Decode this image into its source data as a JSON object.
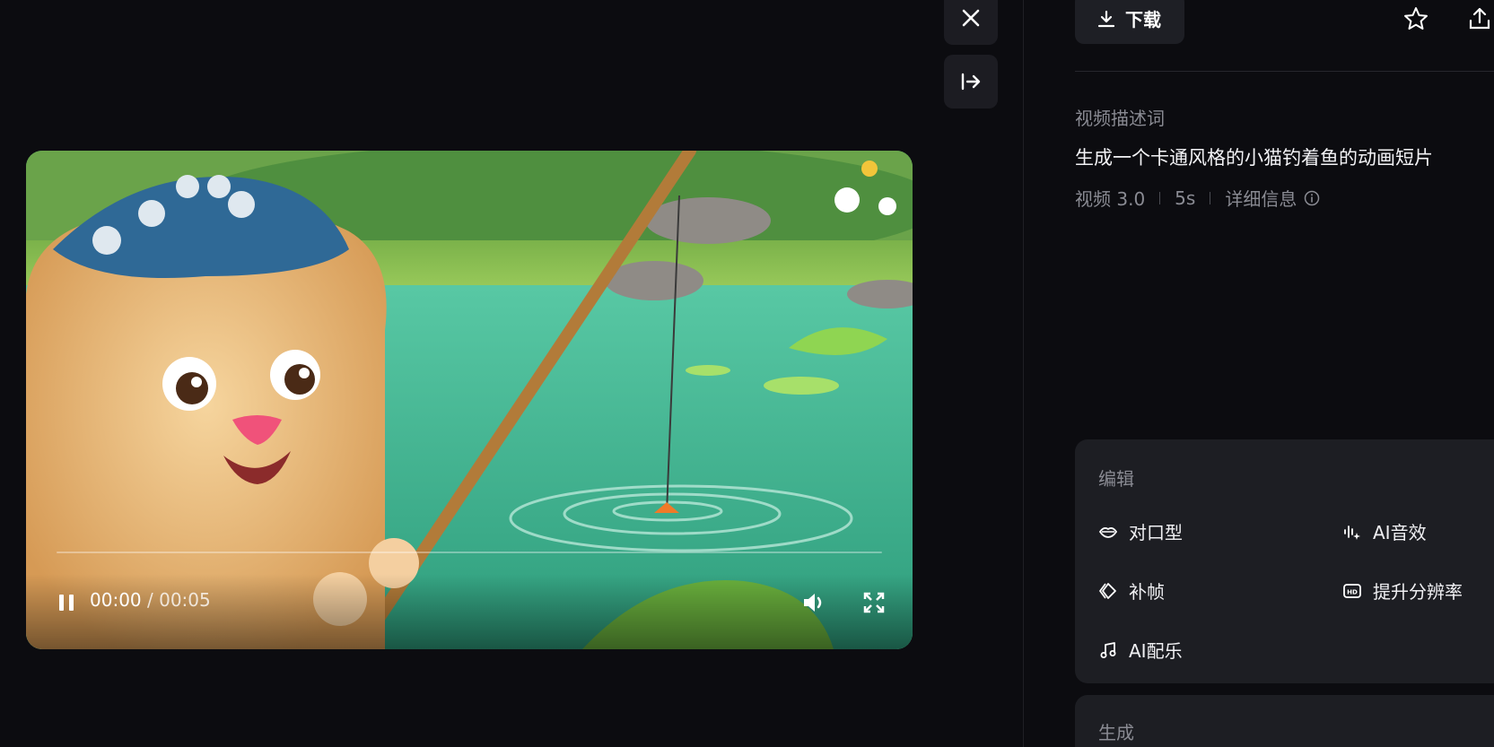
{
  "video": {
    "current_time": "00:00",
    "duration": "/ 00:05",
    "progress": 0.0
  },
  "toolbar": {
    "close_icon": "close-icon",
    "collapse_icon": "arrow-to-right-icon"
  },
  "actions": {
    "download_label": "下载",
    "favorite_icon": "star-icon",
    "share_icon": "share-icon"
  },
  "details": {
    "desc_label": "视频描述词",
    "desc_text": "生成一个卡通风格的小猫钓着鱼的动画短片",
    "model": "视频 3.0",
    "length": "5s",
    "info_label": "详细信息"
  },
  "edit": {
    "title": "编辑",
    "tools": [
      {
        "label": "对口型",
        "icon": "lips-icon"
      },
      {
        "label": "AI音效",
        "icon": "sound-effect-icon"
      },
      {
        "label": "补帧",
        "icon": "frame-interp-icon"
      },
      {
        "label": "提升分辨率",
        "icon": "hd-icon"
      },
      {
        "label": "AI配乐",
        "icon": "music-note-icon"
      }
    ]
  },
  "generate": {
    "title": "生成"
  },
  "colors": {
    "background": "#0c0c10",
    "card": "#1d1e23",
    "muted_text": "#8a8b93"
  }
}
